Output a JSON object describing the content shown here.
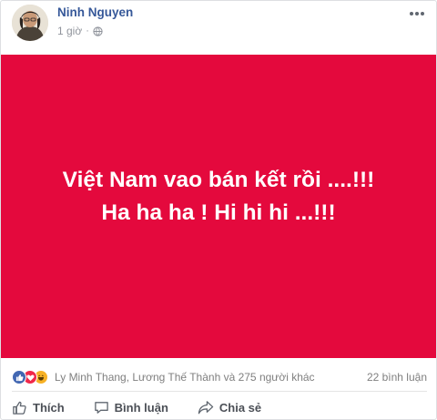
{
  "post": {
    "author": "Ninh Nguyen",
    "time": "1 giờ",
    "separator": "·",
    "privacy_icon": "globe-icon",
    "more_icon": "more-icon"
  },
  "banner": {
    "background_color": "#e4093d",
    "text_color": "#ffffff",
    "line1": "Việt Nam vao bán kết rồi ....!!!",
    "line2": "Ha ha ha ! Hi hi hi ...!!!"
  },
  "reactions": {
    "icons": [
      "like-icon",
      "love-icon",
      "haha-icon"
    ],
    "names": "Ly Minh Thang, Lương Thế Thành và 275 người khác",
    "comments": "22 bình luận"
  },
  "actions": {
    "like": "Thích",
    "comment": "Bình luận",
    "share": "Chia sẻ"
  },
  "colors": {
    "link": "#365899",
    "muted": "#90949c",
    "like_blue": "#4267b2"
  }
}
